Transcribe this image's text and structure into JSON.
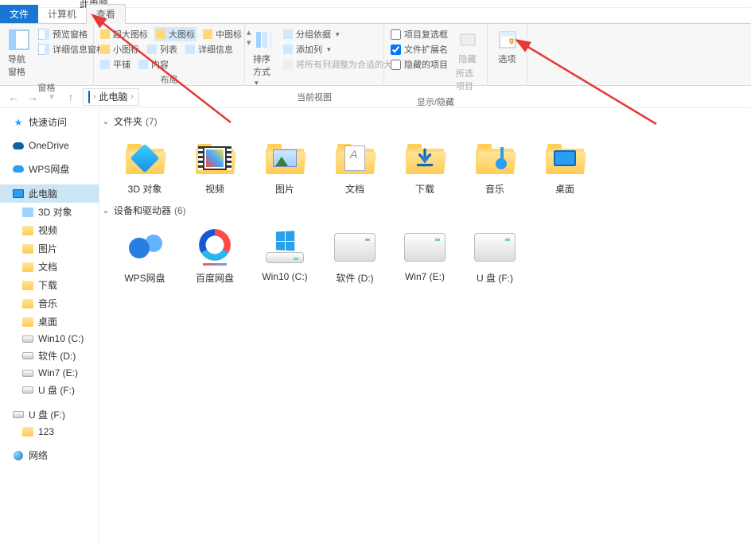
{
  "window": {
    "title": "此电脑"
  },
  "tabs": {
    "file": "文件",
    "computer": "计算机",
    "view": "查看"
  },
  "ribbon": {
    "panes": {
      "nav": "导航窗格",
      "preview": "预览窗格",
      "details": "详细信息窗格",
      "label": "窗格"
    },
    "layout": {
      "xlarge": "超大图标",
      "large": "大图标",
      "medium": "中图标",
      "small": "小图标",
      "list": "列表",
      "detail": "详细信息",
      "tile": "平铺",
      "content": "内容",
      "label": "布局"
    },
    "sort": {
      "btn": "排序方式",
      "caret": "▾"
    },
    "current": {
      "group": "分组依据",
      "add": "添加列",
      "fit": "将所有列调整为合适的大小",
      "label": "当前视图"
    },
    "showhide": {
      "chk": "项目复选框",
      "ext": "文件扩展名",
      "hidden": "隐藏的项目",
      "hidebtn": "隐藏",
      "hidebtn2": "所选项目",
      "label": "显示/隐藏"
    },
    "options": "选项"
  },
  "nav": {
    "back": "←",
    "fwd": "→",
    "up": "↑",
    "crumb_root": "此电脑",
    "sep": "›"
  },
  "side": {
    "quick": "快速访问",
    "onedrive": "OneDrive",
    "wps": "WPS网盘",
    "thispc": "此电脑",
    "items": [
      "3D 对象",
      "视频",
      "图片",
      "文档",
      "下载",
      "音乐",
      "桌面",
      "Win10 (C:)",
      "软件 (D:)",
      "Win7 (E:)",
      "U 盘 (F:)"
    ],
    "usb": "U 盘 (F:)",
    "usb_child": "123",
    "network": "网络"
  },
  "sections": {
    "folders": {
      "title": "文件夹",
      "count": "(7)"
    },
    "drives": {
      "title": "设备和驱动器",
      "count": "(6)"
    }
  },
  "folders": [
    {
      "name": "3D 对象",
      "icon": "3d"
    },
    {
      "name": "视频",
      "icon": "video"
    },
    {
      "name": "图片",
      "icon": "pictures"
    },
    {
      "name": "文档",
      "icon": "docs"
    },
    {
      "name": "下载",
      "icon": "downloads"
    },
    {
      "name": "音乐",
      "icon": "music"
    },
    {
      "name": "桌面",
      "icon": "desktop"
    }
  ],
  "drives": [
    {
      "name": "WPS网盘",
      "icon": "wps"
    },
    {
      "name": "百度网盘",
      "icon": "baidu"
    },
    {
      "name": "Win10 (C:)",
      "icon": "win"
    },
    {
      "name": "软件 (D:)",
      "icon": "drive"
    },
    {
      "name": "Win7 (E:)",
      "icon": "drive"
    },
    {
      "name": "U 盘 (F:)",
      "icon": "drive"
    }
  ]
}
